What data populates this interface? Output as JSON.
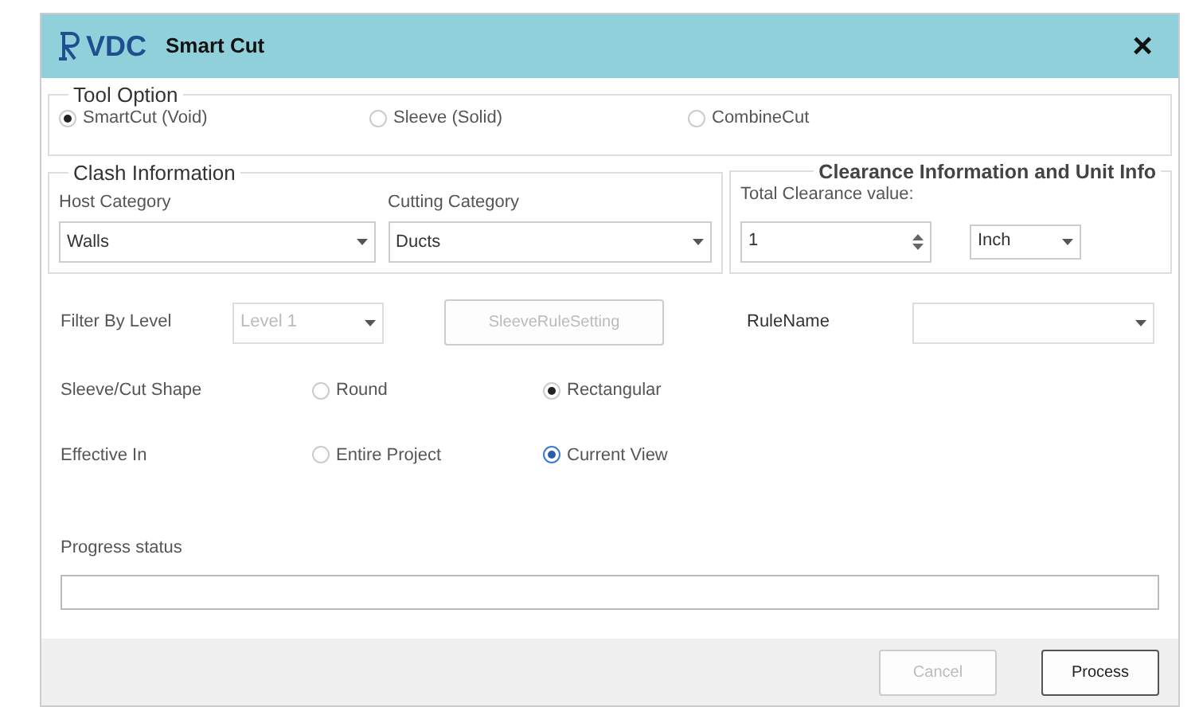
{
  "window": {
    "logo_text": "VDC",
    "title": "Smart Cut",
    "close": "×"
  },
  "tool_option": {
    "legend": "Tool Option",
    "options": [
      {
        "label": "SmartCut (Void)",
        "selected": true
      },
      {
        "label": "Sleeve (Solid)",
        "selected": false
      },
      {
        "label": "CombineCut",
        "selected": false
      }
    ]
  },
  "clash": {
    "legend": "Clash Information",
    "host": {
      "label": "Host Category",
      "value": "Walls"
    },
    "cutting": {
      "label": "Cutting Category",
      "value": "Ducts"
    }
  },
  "clearance": {
    "legend": "Clearance Information and Unit Info",
    "label": "Total Clearance value:",
    "value": "1",
    "unit": "Inch"
  },
  "filter": {
    "label": "Filter By Level",
    "value": "Level 1",
    "disabled": true
  },
  "rule_button": {
    "label": "SleeveRuleSetting",
    "disabled": true
  },
  "rule_name": {
    "label": "RuleName",
    "disabled": true
  },
  "shape": {
    "label": "Sleeve/Cut Shape",
    "options": [
      {
        "label": "Round",
        "selected": false
      },
      {
        "label": "Rectangular",
        "selected": true
      }
    ]
  },
  "effective": {
    "label": "Effective In",
    "options": [
      {
        "label": "Entire Project",
        "selected": false
      },
      {
        "label": "Current View",
        "selected": true
      }
    ]
  },
  "progress": {
    "label": "Progress status",
    "level": 0
  },
  "buttons": [
    {
      "label": "Cancel",
      "disabled": true
    },
    {
      "label": "Process",
      "disabled": false
    }
  ]
}
